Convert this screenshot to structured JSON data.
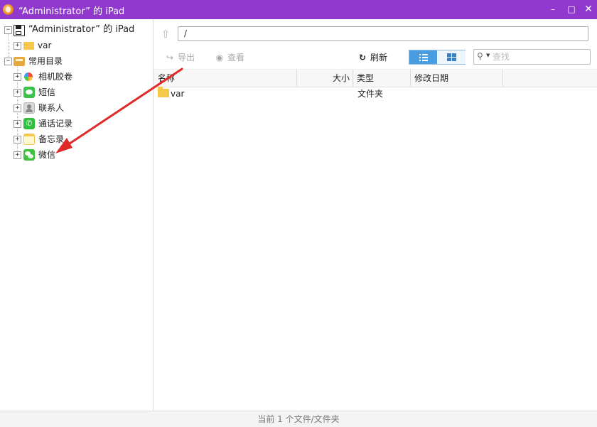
{
  "window": {
    "title": "“Administrator” 的 iPad",
    "controls": [
      "–",
      "□",
      "✕"
    ]
  },
  "tree": {
    "device": {
      "label": "“Administrator” 的 iPad",
      "expander": "−"
    },
    "device_children": [
      {
        "label": "var",
        "expander": "+"
      }
    ],
    "favorites": {
      "label": "常用目录",
      "expander": "−"
    },
    "favorites_children": [
      {
        "label": "相机胶卷",
        "icon": "camera-roll-icon",
        "expander": "+"
      },
      {
        "label": "短信",
        "icon": "messages-icon",
        "expander": "+"
      },
      {
        "label": "联系人",
        "icon": "contacts-icon",
        "expander": "+"
      },
      {
        "label": "通话记录",
        "icon": "phone-icon",
        "expander": "+"
      },
      {
        "label": "备忘录",
        "icon": "notes-icon",
        "expander": "+"
      },
      {
        "label": "微信",
        "icon": "wechat-icon",
        "expander": "+"
      }
    ]
  },
  "path_bar": {
    "value": "/"
  },
  "toolbar": {
    "export_label": "导出",
    "view_label": "查看",
    "refresh_label": "刷新",
    "search_placeholder": "查找"
  },
  "table": {
    "columns": [
      "名称",
      "大小",
      "类型",
      "修改日期"
    ],
    "rows": [
      {
        "name": "var",
        "size": "",
        "type": "文件夹",
        "modified": ""
      }
    ]
  },
  "status": {
    "text": "当前 1 个文件/文件夹"
  },
  "colors": {
    "titlebar": "#9138cf",
    "view_active": "#4a9ce0",
    "annotation_arrow": "#e02a2a"
  }
}
